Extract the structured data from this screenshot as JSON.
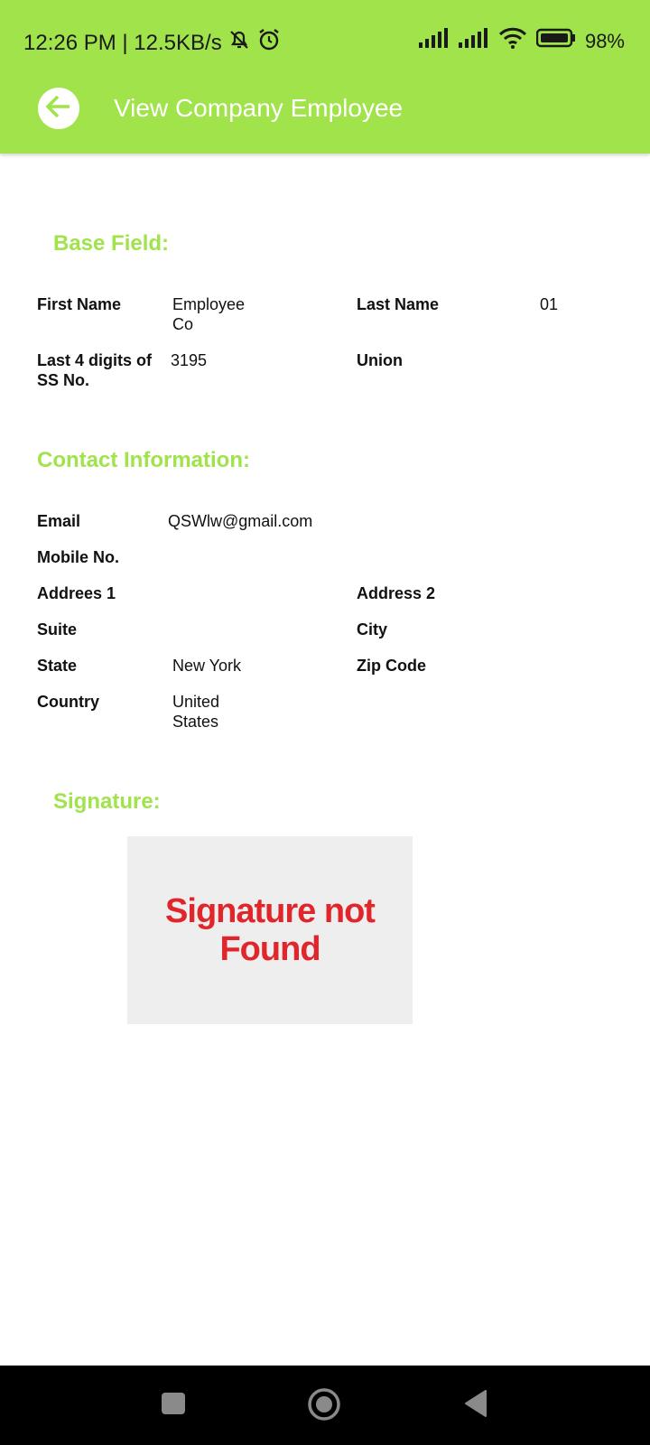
{
  "status_bar": {
    "time": "12:26 PM | 12.5KB/s",
    "battery": "98%"
  },
  "header": {
    "title": "View Company Employee"
  },
  "base_field": {
    "title": "Base Field:",
    "first_name_label": "First Name",
    "first_name_value": "Employee\nCo",
    "last_name_label": "Last Name",
    "last_name_value": "01",
    "ss_label": "Last 4 digits of SS No.",
    "ss_value": "3195",
    "union_label": "Union",
    "union_value": ""
  },
  "contact": {
    "title": "Contact Information:",
    "email_label": "Email",
    "email_value": "QSWlw@gmail.com",
    "mobile_label": "Mobile No.",
    "mobile_value": "",
    "address1_label": "Addrees 1",
    "address1_value": "",
    "address2_label": "Address 2",
    "address2_value": "",
    "suite_label": "Suite",
    "suite_value": "",
    "city_label": "City",
    "city_value": "",
    "state_label": "State",
    "state_value": "New York",
    "zip_label": "Zip Code",
    "zip_value": "",
    "country_label": "Country",
    "country_value": "United\nStates"
  },
  "signature": {
    "title": "Signature:",
    "placeholder_text": "Signature not Found"
  },
  "colors": {
    "accent": "#a0e34a",
    "signature_text": "#e0262b"
  }
}
